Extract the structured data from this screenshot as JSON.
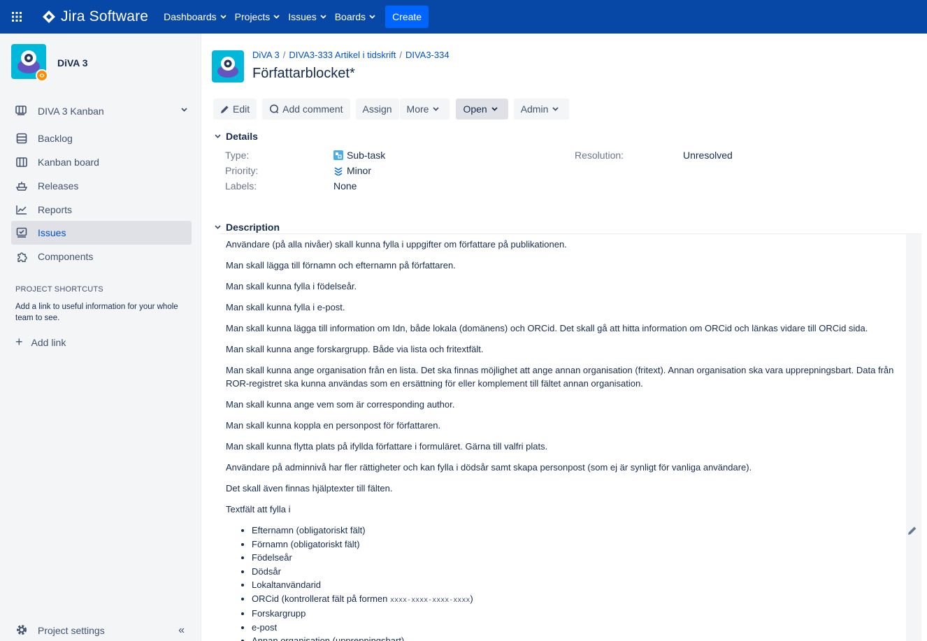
{
  "nav": {
    "product": "Jira Software",
    "items": [
      {
        "label": "Dashboards"
      },
      {
        "label": "Projects"
      },
      {
        "label": "Issues"
      },
      {
        "label": "Boards"
      }
    ],
    "create_label": "Create",
    "icons": {
      "apps": "app-grid-icon",
      "logo": "jira-logo-icon",
      "dropdown": "chevron-down-icon"
    }
  },
  "sidebar": {
    "project_name": "DiVA 3",
    "board_label": "DIVA 3 Kanban",
    "items": [
      {
        "label": "Backlog",
        "icon": "backlog-icon"
      },
      {
        "label": "Kanban board",
        "icon": "board-icon"
      },
      {
        "label": "Releases",
        "icon": "ship-icon"
      },
      {
        "label": "Reports",
        "icon": "chart-icon"
      },
      {
        "label": "Issues",
        "icon": "issues-icon",
        "active": true
      },
      {
        "label": "Components",
        "icon": "puzzle-icon"
      }
    ],
    "shortcuts_title": "PROJECT SHORTCUTS",
    "shortcuts_desc": "Add a link to useful information for your whole team to see.",
    "add_link": "Add link",
    "settings_label": "Project settings",
    "collapse_glyph": "«"
  },
  "issue": {
    "breadcrumbs": [
      "DiVA 3",
      "DIVA3-333 Artikel i tidskrift",
      "DIVA3-334"
    ],
    "title": "Författarblocket*"
  },
  "toolbar": {
    "edit": "Edit",
    "comment": "Add comment",
    "assign": "Assign",
    "more": "More",
    "status": "Open",
    "admin": "Admin"
  },
  "details": {
    "heading": "Details",
    "type_label": "Type:",
    "type_value": "Sub-task",
    "priority_label": "Priority:",
    "priority_value": "Minor",
    "labels_label": "Labels:",
    "labels_value": "None",
    "resolution_label": "Resolution:",
    "resolution_value": "Unresolved"
  },
  "description": {
    "heading": "Description",
    "paragraphs": [
      "Användare (på alla nivåer) skall kunna fylla i uppgifter om författare på publikationen.",
      "Man skall lägga till förnamn och efternamn på författaren.",
      "Man skall kunna fylla i födelseår.",
      "Man skall kunna fylla i e-post.",
      "Man skall kunna lägga till information om Idn, både lokala (domänens) och ORCid. Det skall gå att hitta information om ORCid och länkas vidare till ORCid sida.",
      "Man skall kunna ange forskargrupp. Både via lista och fritextfält.",
      "Man skall kunna ange organisation från en lista. Det ska finnas möjlighet att ange annan organisation (fritext). Annan organisation ska vara upprepningsbart. Data från ROR-registret ska kunna användas som en ersättning för eller komplement till fältet annan organisation.",
      "Man skall kunna ange vem som är corresponding author.",
      "Man skall kunna koppla en personpost för författaren.",
      "Man skall kunna flytta plats på ifyllda författare i formuläret. Gärna till valfri plats.",
      "Användare på adminnivå har fler rättigheter och kan fylla i dödsår samt skapa personpost (som ej är synligt för vanliga användare).",
      "Det skall även finnas hjälptexter till fälten.",
      "Textfält att fylla i"
    ],
    "fields": [
      "Efternamn (obligatoriskt fält)",
      "Förnamn (obligatoriskt fält)",
      "Födelseår",
      "Dödsår",
      "Lokaltanvändarid",
      "Forskargrupp",
      "e-post",
      "Annan organisation (upprepningsbart)"
    ],
    "orcid_prefix": "ORCid (kontrollerat fält på formen ",
    "orcid_format": "xxxx-xxxx-xxxx-xxxx",
    "orcid_suffix": ")"
  }
}
